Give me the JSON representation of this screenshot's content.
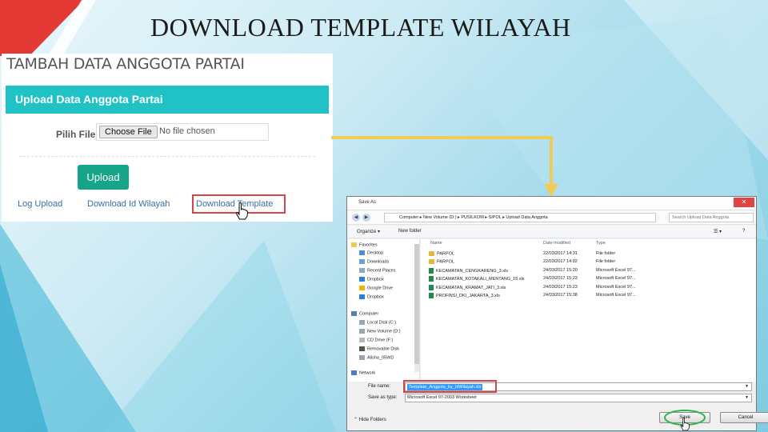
{
  "slide": {
    "title": "DOWNLOAD TEMPLATE WILAYAH"
  },
  "web": {
    "heading": "TAMBAH DATA ANGGOTA PARTAI",
    "card_title": "Upload Data Anggota Partai",
    "field_label": "Pilih File",
    "choose_button": "Choose File",
    "file_status": "No file chosen",
    "upload_button": "Upload",
    "links": {
      "log_upload": "Log Upload",
      "download_wilayah": "Download Id Wilayah",
      "download_template": "Download Template"
    },
    "colors": {
      "header": "#20c2c6",
      "upload": "#17a589",
      "highlight": "#d64545"
    }
  },
  "dialog": {
    "title": "Save As",
    "close_icon": "close-icon",
    "breadcrumb": "Computer ▸ New Volume (D:) ▸ PUSILKOM ▸ SIPOL ▸ Upload Data Anggota",
    "search_placeholder": "Search Upload Data Anggota",
    "toolbar": {
      "organize": "Organize ▾",
      "new_folder": "New folder"
    },
    "nav": {
      "favorites": "Favorites",
      "items_fav": [
        "Desktop",
        "Downloads",
        "Recent Places",
        "Dropbox",
        "Google Drive",
        "Dropbox"
      ],
      "computer": "Computer",
      "items_comp": [
        "Local Disk (C:)",
        "New Volume (D:)",
        "CD Drive (F:)",
        "Removable Disk",
        "Alisha_05WD"
      ],
      "network": "Network"
    },
    "columns": {
      "name": "Name",
      "date": "Date modified",
      "type": "Type"
    },
    "files": [
      {
        "name": "PARPOL",
        "date": "22/03/2017 14:31",
        "type": "File folder",
        "kind": "folder"
      },
      {
        "name": "PARPOL",
        "date": "22/03/2017 14:02",
        "type": "File folder",
        "kind": "folder"
      },
      {
        "name": "KECAMATAN_CENGKARENG_3.xls",
        "date": "24/03/2017 15:20",
        "type": "Microsoft Excel 97...",
        "kind": "xls"
      },
      {
        "name": "KECAMATAN_KOTAKALI_MENTANG_15.xls",
        "date": "24/03/2017 15:23",
        "type": "Microsoft Excel 97...",
        "kind": "xls"
      },
      {
        "name": "KECAMATAN_KRAMAT_JATI_3.xls",
        "date": "24/03/2017 15:23",
        "type": "Microsoft Excel 97...",
        "kind": "xls"
      },
      {
        "name": "PROFINSI_DKI_JAKARTA_3.xls",
        "date": "24/03/2017 15:38",
        "type": "Microsoft Excel 97...",
        "kind": "xls"
      }
    ],
    "file_name_label": "File name:",
    "file_name_value": "Template_Anggota_by_IdWilayah.xls",
    "save_type_label": "Save as type:",
    "save_type_value": "Microsoft Excel 97-2003 Worksheet",
    "hide_folders": "Hide Folders",
    "save_button": "Save",
    "cancel_button": "Cancel"
  }
}
